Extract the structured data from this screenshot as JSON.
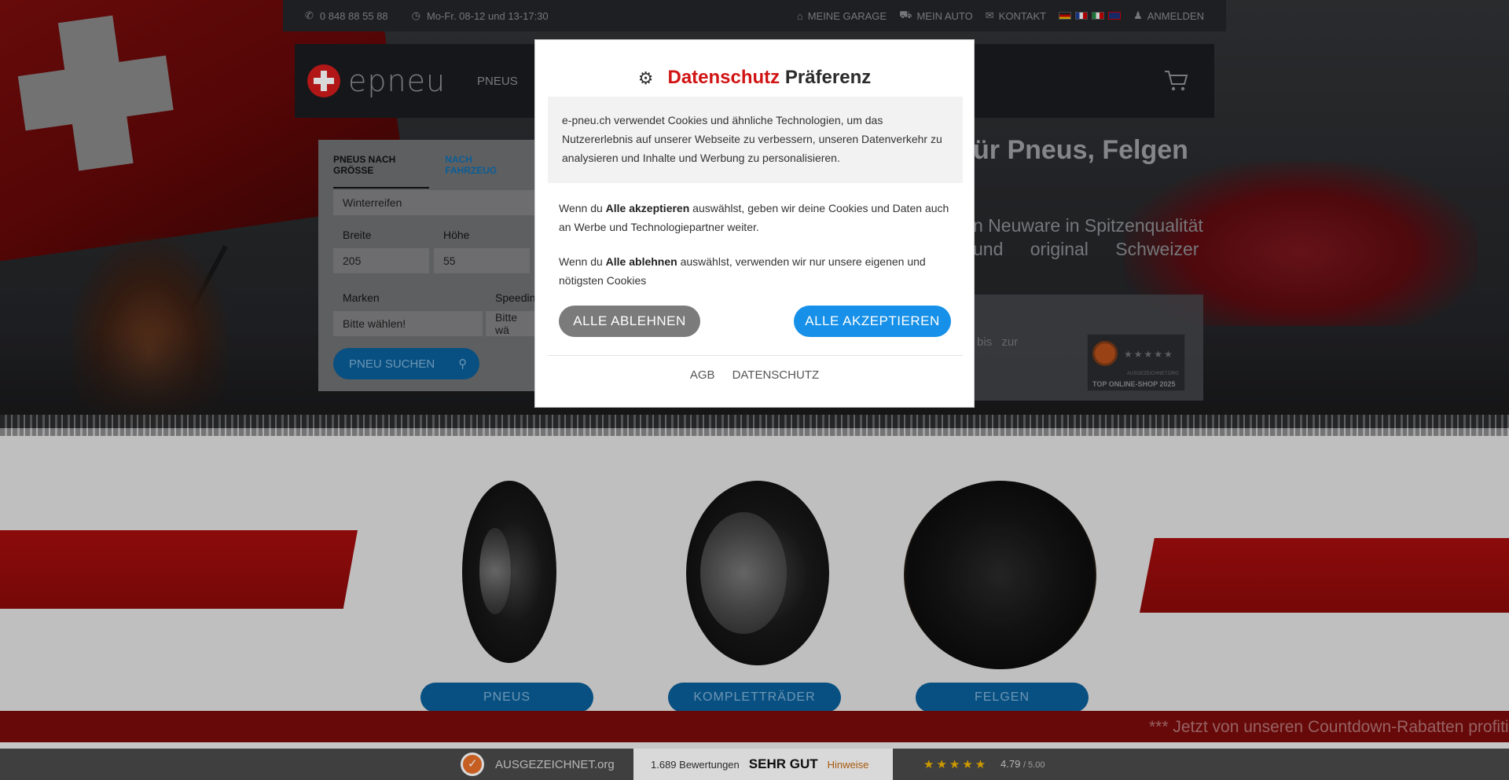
{
  "topbar": {
    "phone": "0 848 88 55 88",
    "hours": "Mo-Fr. 08-12 und 13-17:30",
    "links": [
      "MEINE GARAGE",
      "MEIN AUTO",
      "KONTAKT"
    ],
    "login": "ANMELDEN",
    "languages": [
      "de",
      "fr",
      "it",
      "en"
    ]
  },
  "nav": {
    "logo": "epneu",
    "first_link": "PNEUS"
  },
  "search": {
    "tab_size": "PNEUS NACH GRÖSSE",
    "tab_vehicle": "NACH FAHRZEUG",
    "season": "Winterreifen",
    "width_label": "Breite",
    "height_label": "Höhe",
    "width_value": "205",
    "height_value": "55",
    "brand_label": "Marken",
    "speed_label": "Speedin",
    "brand_value": "Bitte wählen!",
    "speed_value": "Bitte wä",
    "button": "PNEU SUCHEN"
  },
  "hero": {
    "title": "ür Pneus, Felgen",
    "line1": "n Neuware in Spitzenqualität",
    "line2": "und original Schweizer",
    "info_text": "bis zur",
    "badge_label": "AUSGEZEICHNET.ORG",
    "badge_text": "TOP ONLINE-SHOP 2025"
  },
  "modal": {
    "title_red": "Datenschutz",
    "title_dark": "Präferenz",
    "intro": "e-pneu.ch verwendet Cookies und ähnliche Technologien, um das Nutzererlebnis auf unserer Webseite zu verbessern, unseren Datenverkehr zu analysieren und Inhalte und Werbung zu personalisieren.",
    "p1_prefix": "Wenn du ",
    "p1_bold": "Alle akzeptieren",
    "p1_rest": " auswählst, geben wir deine Cookies und Daten auch an Werbe und Technologiepartner weiter.",
    "p2_prefix": "Wenn du ",
    "p2_bold": "Alle ablehnen",
    "p2_rest": " auswählst, verwenden wir nur unsere eigenen und nötigsten Cookies",
    "reject": "ALLE ABLEHNEN",
    "accept": "ALLE AKZEPTIEREN",
    "link_agb": "AGB",
    "link_privacy": "DATENSCHUTZ"
  },
  "products": [
    {
      "label": "PNEUS"
    },
    {
      "label": "KOMPLETTRÄDER"
    },
    {
      "label": "FELGEN"
    }
  ],
  "ticker": "*** Jetzt von unseren Countdown-Rabatten profitieren",
  "rating": {
    "brand": "AUSGEZEICHNET.org",
    "count": "1.689 Bewertungen",
    "grade": "SEHR GUT",
    "hint": "Hinweise",
    "score": "4.79",
    "max": "/ 5.00"
  },
  "colors": {
    "accent_red": "#d11414",
    "accept_blue": "#1690e8",
    "reject_grey": "#7b7b7b"
  }
}
